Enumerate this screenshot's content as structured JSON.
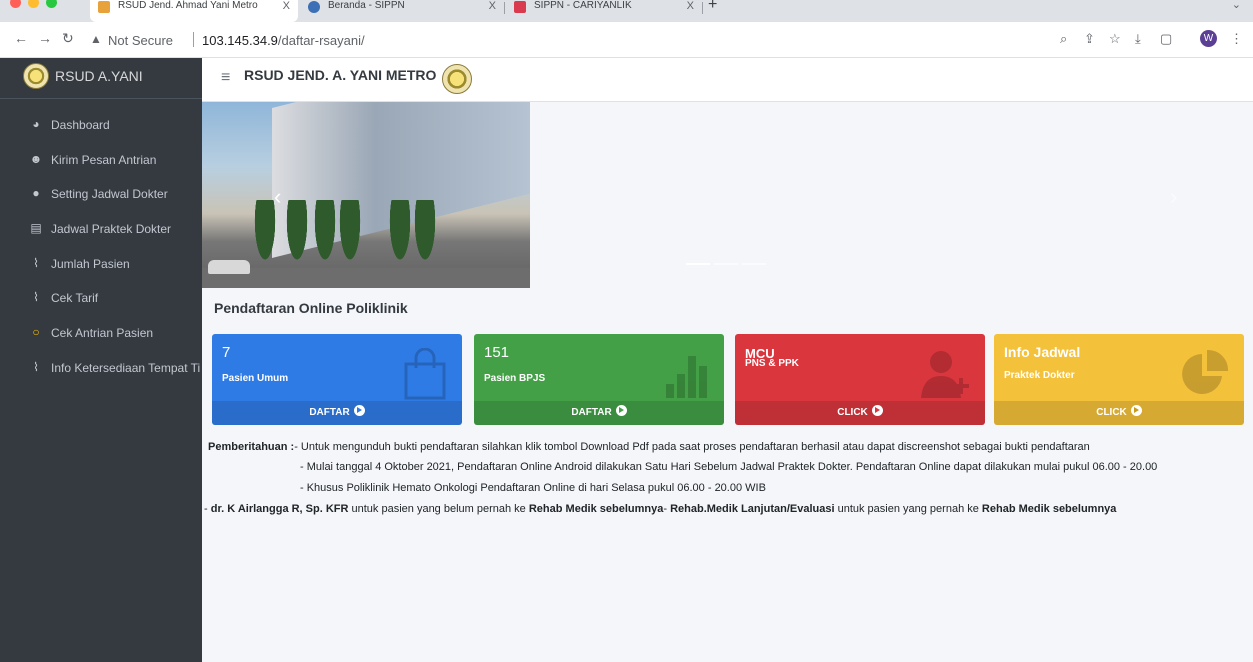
{
  "browser": {
    "tabs": [
      {
        "title": "RSUD Jend. Ahmad Yani Metro",
        "close": "X"
      },
      {
        "title": "Beranda - SIPPN",
        "close": "X"
      },
      {
        "title": "SIPPN - CARIYANLIK",
        "close": "X"
      }
    ],
    "new_tab": "+",
    "security_label": "Not Secure",
    "url_host": "103.145.34.9",
    "url_path": "/daftar-rsayani/",
    "profile_initial": "W"
  },
  "sidebar": {
    "brand": "RSUD A.YANI",
    "items": [
      {
        "label": "Dashboard",
        "icon": "dashboard-icon"
      },
      {
        "label": "Kirim Pesan Antrian",
        "icon": "users-icon"
      },
      {
        "label": "Setting Jadwal Dokter",
        "icon": "user-icon"
      },
      {
        "label": "Jadwal Praktek Dokter",
        "icon": "book-icon"
      },
      {
        "label": "Jumlah Pasien",
        "icon": "chart-line-icon"
      },
      {
        "label": "Cek Tarif",
        "icon": "chart-line-icon"
      },
      {
        "label": "Cek Antrian Pasien",
        "icon": "circle-icon"
      },
      {
        "label": "Info Ketersediaan Tempat Ti",
        "icon": "chart-line-icon"
      }
    ]
  },
  "navbar": {
    "title": "RSUD JEND. A. YANI METRO"
  },
  "section": {
    "title": "Pendaftaran Online Poliklinik"
  },
  "cards": [
    {
      "value": "7",
      "label": "Pasien Umum",
      "action": "DAFTAR",
      "color": "#2f7be5"
    },
    {
      "value": "151",
      "label": "Pasien BPJS",
      "action": "DAFTAR",
      "color": "#43a047"
    },
    {
      "value": "MCU",
      "label": "PNS & PPK",
      "action": "CLICK",
      "color": "#d9363e"
    },
    {
      "value": "Info Jadwal",
      "label": "Praktek Dokter",
      "action": "CLICK",
      "color": "#f4c13a"
    }
  ],
  "notice": {
    "heading": "Pemberitahuan :",
    "line1": "- Untuk mengunduh bukti pendaftaran silahkan klik tombol Download Pdf pada saat proses pendaftaran berhasil atau dapat discreenshot sebagai bukti pendaftaran",
    "line2": "- Mulai tanggal 4 Oktober 2021, Pendaftaran Online Android dilakukan Satu Hari Sebelum Jadwal Praktek Dokter. Pendaftaran Online dapat dilakukan mulai pukul 06.00 - 20.00",
    "line3": "- Khusus Poliklinik Hemato Onkologi Pendaftaran Online di hari Selasa pukul 06.00 - 20.00 WIB",
    "line4": {
      "p1": "- ",
      "b1": "dr. K Airlangga R, Sp. KFR",
      "p2": " untuk pasien yang belum pernah ke ",
      "b2": "Rehab Medik sebelumnya",
      "p3": "- ",
      "b3": "Rehab.Medik Lanjutan/Evaluasi",
      "p4": " untuk pasien yang pernah ke ",
      "b4": "Rehab Medik sebelumnya"
    }
  }
}
